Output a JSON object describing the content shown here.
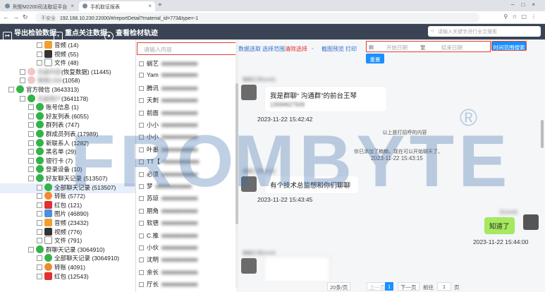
{
  "browser": {
    "tabs": [
      {
        "title": "刑型M2200司法取证平台"
      },
      {
        "title": "手机取证报表"
      }
    ],
    "insecure_label": "不安全",
    "url": "192.168.10.230:22000/#/reportDetail?material_id=773&type=-1"
  },
  "header": {
    "export_label": "导出检验数据",
    "focus_label": "重点关注数据",
    "view_label": "查看检材轨迹",
    "search_placeholder": "请输入关键字进行全文搜索"
  },
  "tree": [
    {
      "label": "音频 (14)",
      "icon": "music-icon",
      "indent": 52
    },
    {
      "label": "视频 (55)",
      "icon": "video-icon",
      "indent": 52
    },
    {
      "label": "文件 (48)",
      "icon": "file-icon",
      "indent": 52
    },
    {
      "label": "(恢复数据) (11445)",
      "icon": "pale-avatar-icon",
      "indent": 28,
      "blurred_prefix": "无副内容"
    },
    {
      "label": "(1058)",
      "icon": "pale-avatar-icon",
      "indent": 28,
      "blurred_prefix": "微微1394"
    },
    {
      "label": "官方微信 (3643313)",
      "icon": "wechat-icon",
      "indent": 12
    },
    {
      "label": "(3641178)",
      "icon": "wechat-icon",
      "indent": 28,
      "blurred_prefix": "无副用户"
    },
    {
      "label": "账号信息 (1)",
      "icon": "wechat-icon",
      "indent": 40
    },
    {
      "label": "好友列表 (6055)",
      "icon": "wechat-icon",
      "indent": 40
    },
    {
      "label": "群列表 (747)",
      "icon": "wechat-icon",
      "indent": 40
    },
    {
      "label": "群成员列表 (17989)",
      "icon": "wechat-icon",
      "indent": 40
    },
    {
      "label": "新联系人 (1282)",
      "icon": "wechat-icon",
      "indent": 40
    },
    {
      "label": "黑名单 (29)",
      "icon": "wechat-icon",
      "indent": 40
    },
    {
      "label": "银行卡 (7)",
      "icon": "wechat-icon",
      "indent": 40
    },
    {
      "label": "登录设备 (10)",
      "icon": "wechat-icon",
      "indent": 40
    },
    {
      "label": "好友聊天记录 (513507)",
      "icon": "wechat-icon",
      "indent": 40
    },
    {
      "label": "全部聊天记录 (513507)",
      "icon": "wechat-icon",
      "indent": 52,
      "selected": true
    },
    {
      "label": "转账 (5772)",
      "icon": "transfer-icon",
      "indent": 52
    },
    {
      "label": "红包 (121)",
      "icon": "red-packet-icon",
      "indent": 52
    },
    {
      "label": "图片 (46890)",
      "icon": "image-icon",
      "indent": 52
    },
    {
      "label": "音频 (23432)",
      "icon": "music-icon",
      "indent": 52
    },
    {
      "label": "视频 (776)",
      "icon": "video-icon",
      "indent": 52
    },
    {
      "label": "文件 (791)",
      "icon": "file-icon",
      "indent": 52
    },
    {
      "label": "群聊天记录 (3064910)",
      "icon": "wechat-icon",
      "indent": 40
    },
    {
      "label": "全部聊天记录 (3064910)",
      "icon": "wechat-icon",
      "indent": 52
    },
    {
      "label": "转账 (4091)",
      "icon": "transfer-icon",
      "indent": 52
    },
    {
      "label": "红包 (12543)",
      "icon": "red-packet-icon",
      "indent": 52
    }
  ],
  "midlist": {
    "search_placeholder": "请输入内容",
    "items": [
      {
        "label": "蜗艺"
      },
      {
        "label": "Yam"
      },
      {
        "label": "腾讯"
      },
      {
        "label": "天刺"
      },
      {
        "label": "前面"
      },
      {
        "label": "小小"
      },
      {
        "label": "小小"
      },
      {
        "label": "叶墨"
      },
      {
        "label": "TT【"
      },
      {
        "label": "必须"
      },
      {
        "label": "梦"
      },
      {
        "label": "苏琼"
      },
      {
        "label": "朋角"
      },
      {
        "label": "软德"
      },
      {
        "label": "C.推"
      },
      {
        "label": "小伙"
      },
      {
        "label": "沈明"
      },
      {
        "label": "余长"
      },
      {
        "label": "厅长"
      }
    ]
  },
  "toolbar": {
    "select_data": "数据选取",
    "select_range": "选择范围",
    "clear_select": "清除选择",
    "dash": "-",
    "capture_preview": "截图预览",
    "print": "打印",
    "start_date": "开始日期",
    "to": "至",
    "end_date": "结束日期",
    "time_search": "时间范围搜索",
    "reset": "重置"
  },
  "messages": [
    {
      "text": "我是群聊“        沟通群”的前台王琴",
      "subtext": "13584627509",
      "time": "2023-11-22 15:42:42"
    },
    {
      "system1": "以上是打招呼的内容",
      "system2": "你已添加了楠楠，现在可以开始聊天了。",
      "system_time": "2023-11-22 15:43:15"
    },
    {
      "text": "有个技术总监想和你们聊聊",
      "time": "2023-11-22 15:43:45"
    },
    {
      "text": "知道了",
      "time": "2023-11-22 15:44:00",
      "mine": true
    }
  ],
  "pagination": {
    "page_size": "20条/页",
    "prev": "上一页",
    "current": "1",
    "next": "下一页",
    "goto_label": "前往",
    "goto_value": "1",
    "page_label": "页"
  },
  "watermark": "FROMBYTE"
}
